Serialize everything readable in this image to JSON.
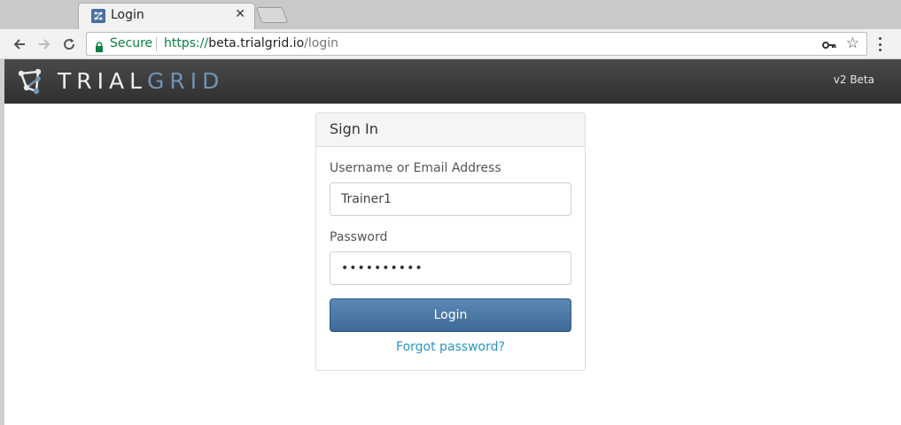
{
  "browser": {
    "tab": {
      "title": "Login"
    },
    "address_bar": {
      "secure_label": "Secure",
      "url_scheme": "https://",
      "url_host": "beta.trialgrid.io",
      "url_path": "/login"
    }
  },
  "header": {
    "brand_part1": "TRIAL",
    "brand_part2": "GRID",
    "version": "v2 Beta"
  },
  "login": {
    "title": "Sign In",
    "username_label": "Username or Email Address",
    "username_value": "Trainer1",
    "password_label": "Password",
    "password_masked": "••••••••••",
    "login_button": "Login",
    "forgot_link": "Forgot password?"
  },
  "colors": {
    "secure_green": "#0b8043",
    "brand_blue": "#6f93b8",
    "button_blue": "#4a78a6",
    "link_blue": "#2a94c4"
  }
}
